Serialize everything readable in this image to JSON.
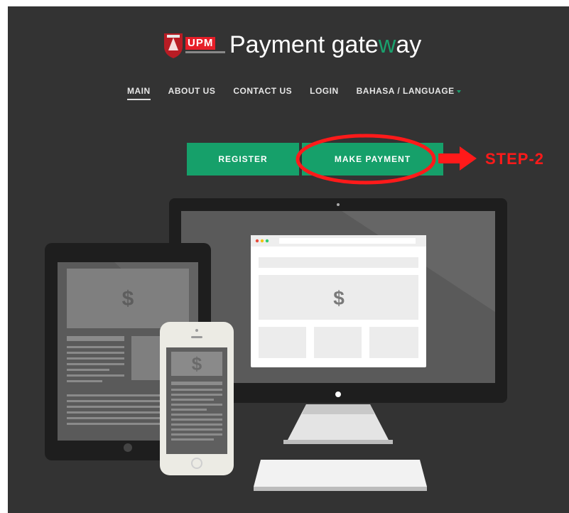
{
  "brand": {
    "badge": "UPM",
    "title_main": "Payment gate",
    "title_accent": "w",
    "title_end": "ay",
    "accent_color": "#1aa06d",
    "badge_color": "#e61e28"
  },
  "nav": {
    "items": [
      "MAIN",
      "ABOUT US",
      "CONTACT US",
      "LOGIN",
      "BAHASA / LANGUAGE"
    ],
    "active": "MAIN"
  },
  "actions": {
    "register_label": "REGISTER",
    "pay_label": "MAKE PAYMENT",
    "button_color": "#16a06a"
  },
  "annotation": {
    "step_label": "STEP-2",
    "color": "#ff1a1a"
  },
  "illustration": {
    "symbol": "$"
  }
}
